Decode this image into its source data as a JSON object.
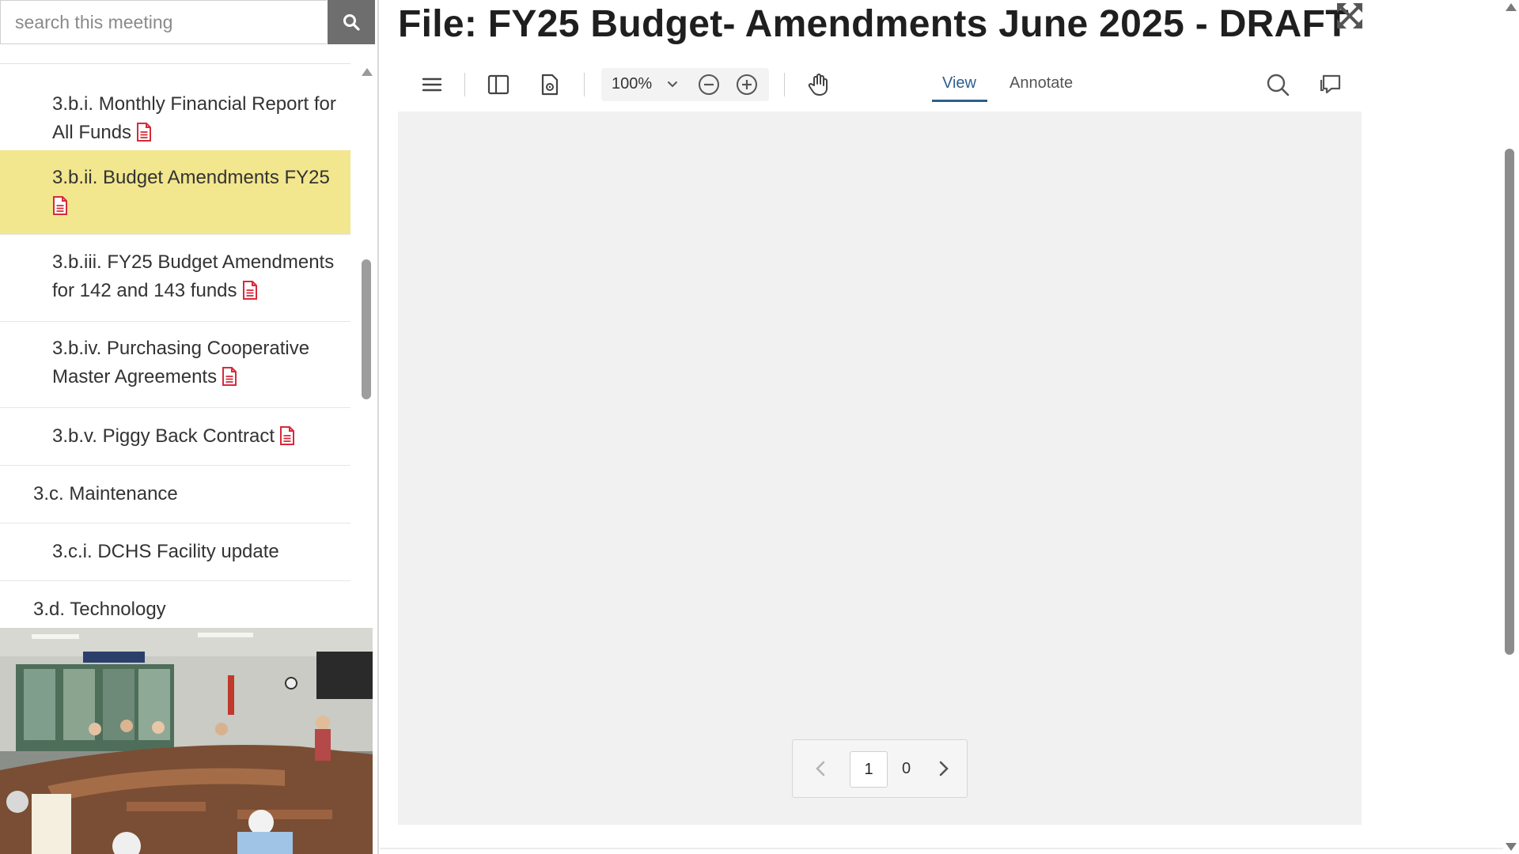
{
  "search": {
    "placeholder": "search this meeting",
    "value": ""
  },
  "agenda": {
    "items": [
      {
        "label": "3.b.i. Monthly Financial Report for All Funds",
        "has_attachment": true,
        "level": "sub",
        "active": false
      },
      {
        "label": "3.b.ii. Budget Amendments FY25",
        "has_attachment": true,
        "level": "sub",
        "active": true
      },
      {
        "label": "3.b.iii.  FY25 Budget Amendments for 142 and 143 funds",
        "has_attachment": true,
        "level": "sub",
        "active": false
      },
      {
        "label": "3.b.iv. Purchasing Cooperative Master Agreements",
        "has_attachment": true,
        "level": "sub",
        "active": false
      },
      {
        "label": "3.b.v. Piggy Back Contract",
        "has_attachment": true,
        "level": "sub",
        "active": false
      },
      {
        "label": "3.c. Maintenance",
        "has_attachment": false,
        "level": "top",
        "active": false
      },
      {
        "label": "3.c.i. DCHS Facility update",
        "has_attachment": false,
        "level": "sub",
        "active": false
      },
      {
        "label": "3.d. Technology",
        "has_attachment": false,
        "level": "top",
        "active": false
      }
    ]
  },
  "viewer": {
    "title": "File:  FY25 Budget- Amendments June 2025 - DRAFT",
    "zoom": "100%",
    "tabs": {
      "view": "View",
      "annotate": "Annotate"
    },
    "pager": {
      "current_page": "1",
      "total_pages": "0"
    }
  },
  "colors": {
    "active_item": "#f2e68e",
    "accent": "#2d5f8d",
    "pdf_icon": "#d62b3a",
    "search_button": "#6e6e6e"
  }
}
